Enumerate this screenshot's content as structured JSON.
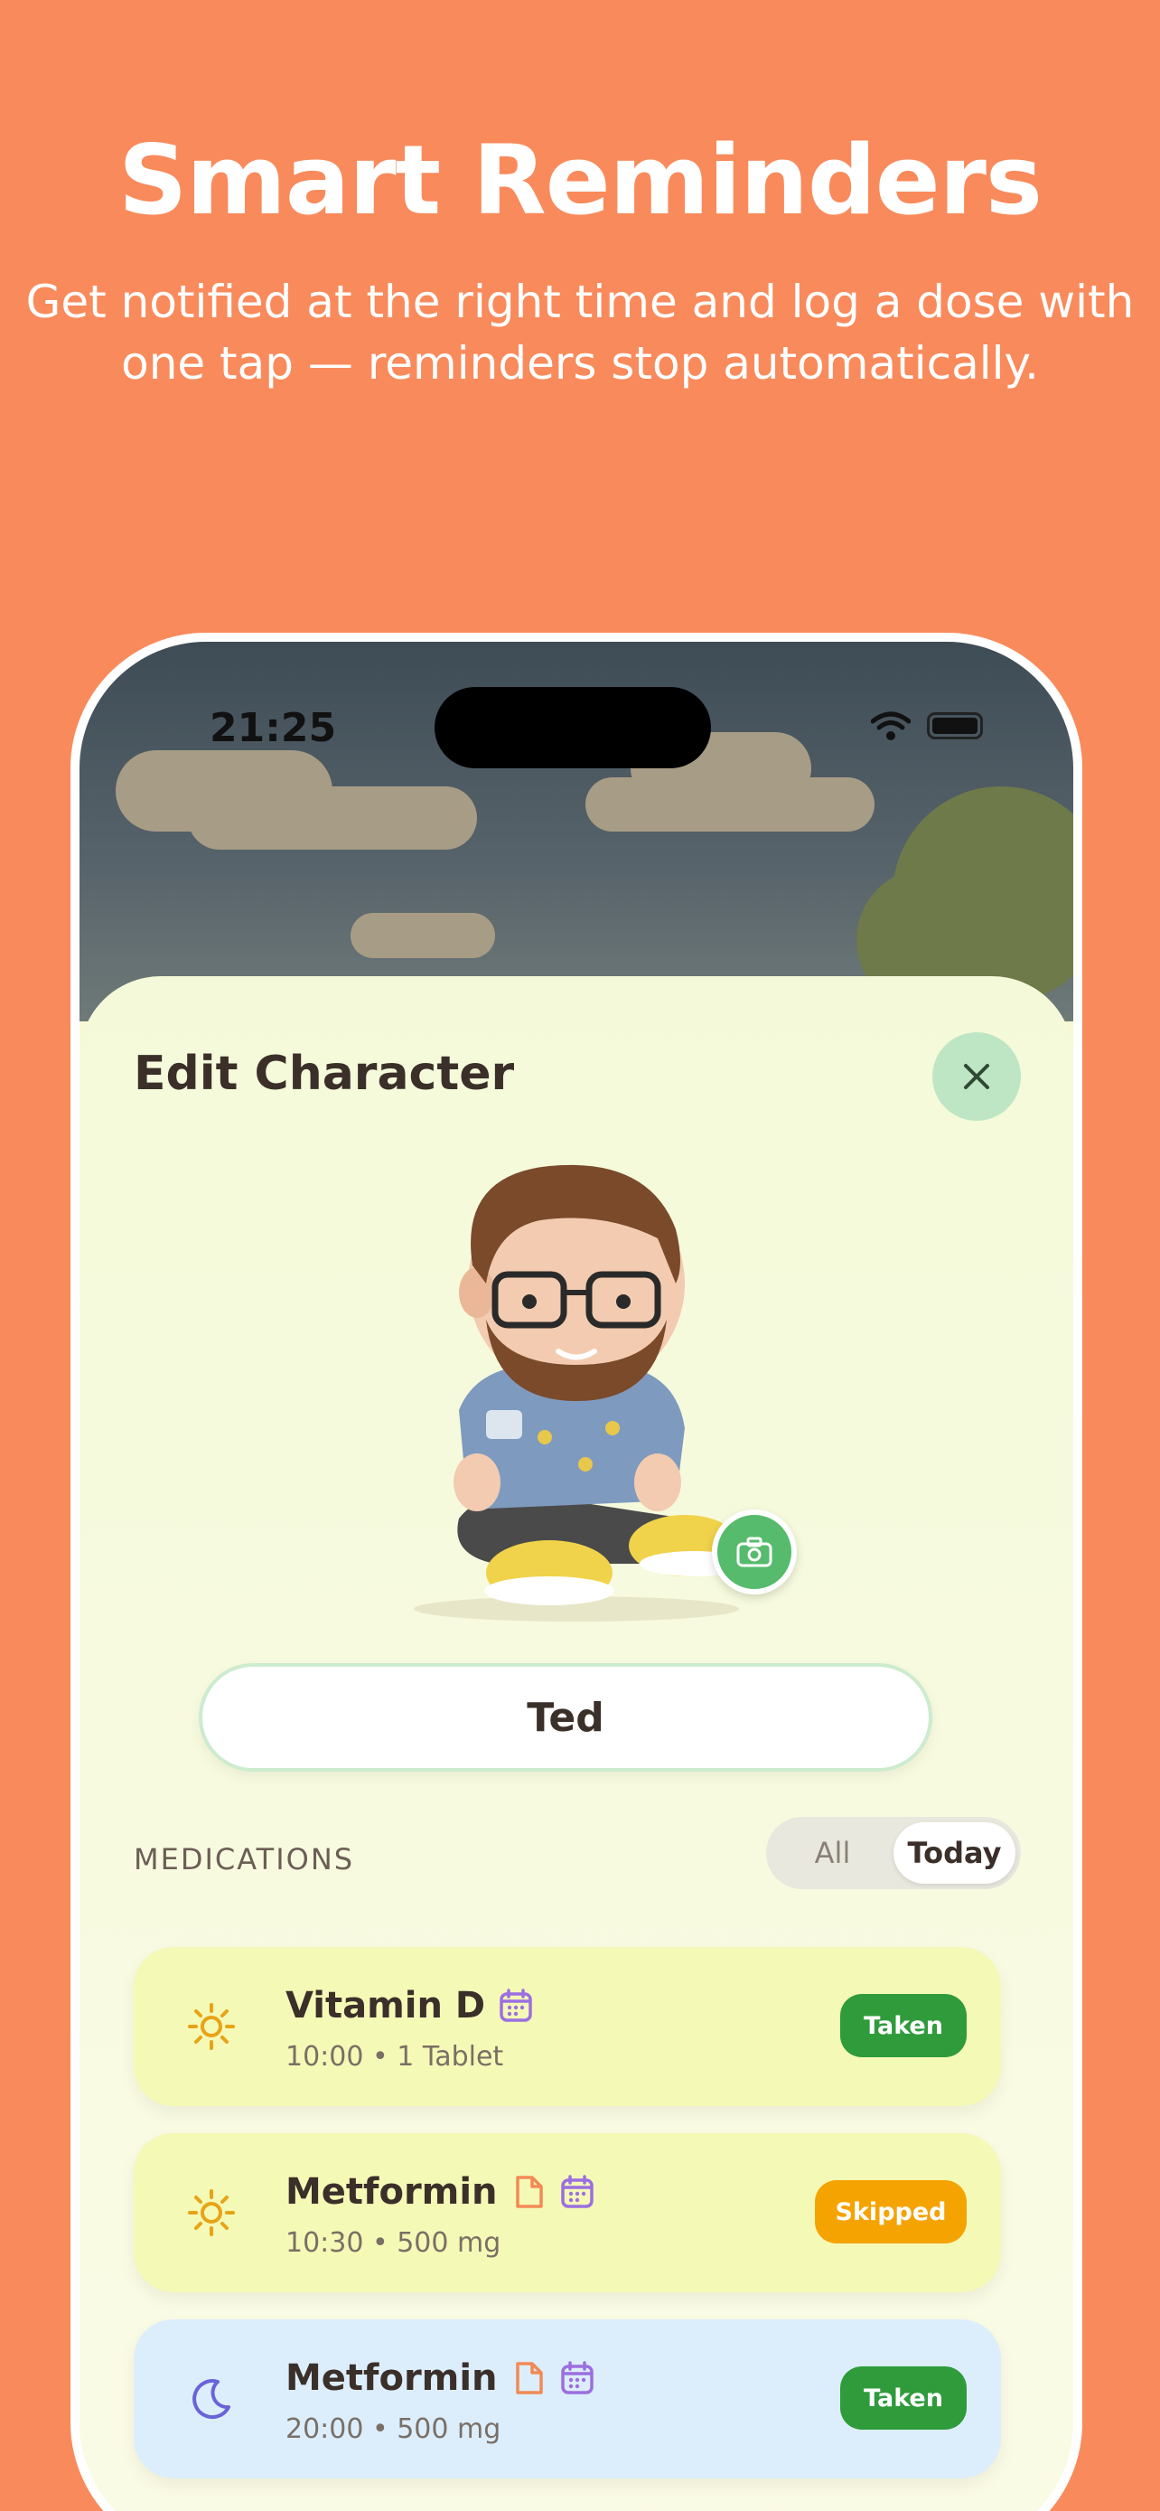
{
  "promo": {
    "title": "Smart Reminders",
    "subtitle_line1": "Get notified at the right time and log a dose with",
    "subtitle_line2": "one tap — reminders stop automatically."
  },
  "status_bar": {
    "time": "21:25"
  },
  "sheet": {
    "title": "Edit Character",
    "name_value": "Ted",
    "section_label": "MEDICATIONS",
    "filter_options": [
      "All",
      "Today"
    ],
    "filter_selected": "Today"
  },
  "medications": [
    {
      "icon": "sun-icon",
      "name": "Vitamin D",
      "time": "10:00",
      "dose": "1 Tablet",
      "status": "Taken",
      "card_color": "#F5F9B6",
      "status_color": "#2F9B3B"
    },
    {
      "icon": "sun-icon",
      "name": "Metformin",
      "time": "10:30",
      "dose": "500 mg",
      "status": "Skipped",
      "card_color": "#F5F9B6",
      "status_color": "#F5A300"
    },
    {
      "icon": "moon-icon",
      "name": "Metformin",
      "time": "20:00",
      "dose": "500 mg",
      "status": "Taken",
      "card_color": "#DCEEFC",
      "status_color": "#2F9B3B"
    }
  ],
  "med_sub": [
    "10:00 • 1 Tablet",
    "10:30 • 500 mg",
    "20:00 • 500 mg"
  ],
  "colors": {
    "background": "#F98A5B",
    "accent_green": "#56BB6C",
    "sheet": "#F4FAD9"
  }
}
